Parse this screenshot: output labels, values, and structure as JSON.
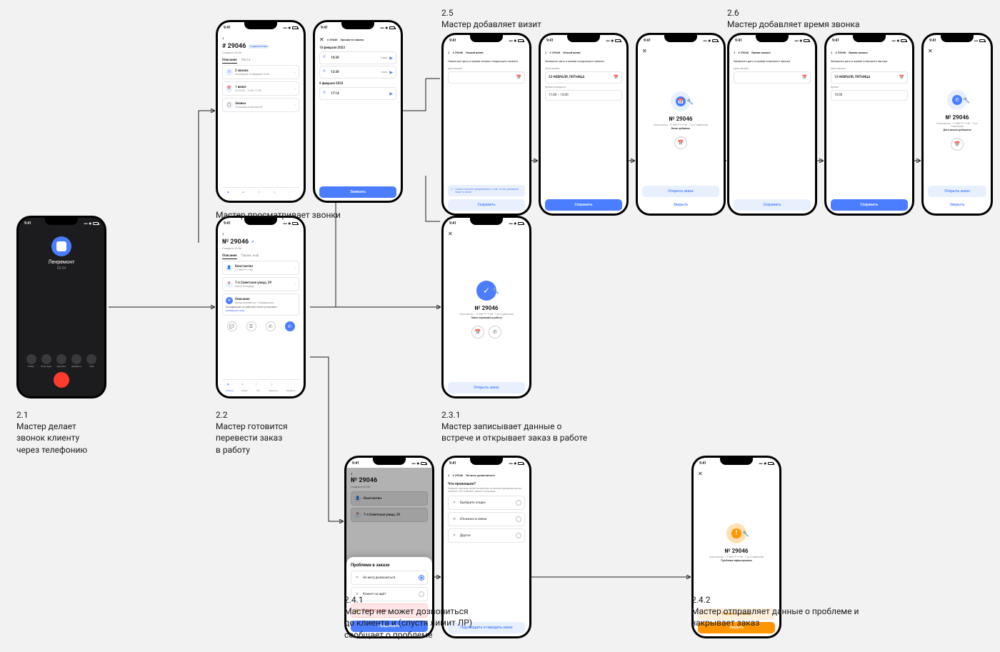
{
  "status_time": "9:41",
  "captions": {
    "c21": {
      "num": "2.1",
      "text": "Мастер делает\nзвонок клиенту\nчерез телефонию"
    },
    "c22": {
      "num": "2.2",
      "text": "Мастер готовится\nперевести заказ\nв работу"
    },
    "c_calls": "Мастер просматривает звонки",
    "c25": {
      "num": "2.5",
      "text": "Мастер добавляет визит"
    },
    "c26": {
      "num": "2.6",
      "text": "Мастер добавляет время звонка"
    },
    "c231": {
      "num": "2.3.1",
      "text": "Мастер записывает данные о\nвстрече и открывает заказ в работе"
    },
    "c241": {
      "num": "2.4.1",
      "text": "Мастер не может дозвониться\nдо клиента и (спустя лимит ЛР)\nсообщает о проблеме"
    },
    "c242": {
      "num": "2.4.2",
      "text": "Мастер отправляет данные о проблеме и\nзакрывает заказ"
    }
  },
  "call_screen": {
    "name": "Ленремонт",
    "duration": "00:04",
    "buttons": [
      "Набор",
      "Выкл звук",
      "Динамик",
      "Добавить",
      "Ещё"
    ]
  },
  "order": {
    "number": "# 29046",
    "number_plain": "№ 29046",
    "badge": "К диагностике",
    "created": "Создано 30.06",
    "tabs": [
      "Описание",
      "Лента"
    ],
    "tabs2": [
      "Описание",
      "Парам. инф."
    ],
    "calls_card": {
      "title": "2 звонка",
      "sub": "Последний 18 февраля 10:04"
    },
    "visit_card": {
      "title": "1 визит",
      "sub": "Пн 23.02 · 12:00–17:00"
    },
    "task_card": {
      "title": "Заявка",
      "sub": "Установка и монтаж БТ"
    },
    "client_card": {
      "title": "Константин",
      "sub": "+7 906 *** ** 60"
    },
    "address_card": {
      "title": "7-я Советская улица, 29",
      "sub": "Санкт-Петербург"
    },
    "desc_card": {
      "title": "Описание",
      "sub": "Бренд неизвестен · Холодильник",
      "body": "Холодильник не работает после установки...",
      "more": "развернуть ещё"
    }
  },
  "nav": [
    "Заказы",
    "Карта",
    "Чат",
    "Финансы",
    "Профиль"
  ],
  "calls_log": {
    "header_label": "Звонки по заказу",
    "date1": "10 февраля 2023",
    "items1": [
      {
        "time": "10:39",
        "dur": "2 мин"
      },
      {
        "time": "12:36",
        "dur": "5 мин"
      }
    ],
    "date2": "9 февраля 2023",
    "items2": [
      {
        "time": "17:14",
        "dur": ""
      }
    ],
    "action": "Записать"
  },
  "visit_form": {
    "breadcrumb": "Новый визит",
    "title1": "Назначьте дату и время начала следующего визита",
    "date_label": "Дата визита",
    "date_value": "",
    "title2": "Запишите дату и время следующего визита",
    "date_big": "22 ФЕВРАЛЯ, ПЯТНИЦА",
    "time_label": "Время и продолж.",
    "time_value": "11:00 – 14:00",
    "save": "Сохранить",
    "info": "Клиент получит уведомление о том, что вы добавили визит в заказ"
  },
  "visit_success": {
    "title": "№ 29046",
    "sub1": "Константин · +7 906 *** ** 60 · 7 р-н Советская",
    "sub2": "Визит добавлен",
    "action1": "Открыть заказ",
    "action2": "Закрыть"
  },
  "call_time_form": {
    "breadcrumb": "Время звонка",
    "title1": "Запишите дату и время планового звонка",
    "date_label": "Дата звонка",
    "title2": "Запишите дату и время планового звонка",
    "date_big": "13 ФЕВРАЛЯ, ПЯТНИЦА",
    "time_label": "Время",
    "time_value": "10:00",
    "save": "Сохранить"
  },
  "call_success": {
    "title": "№ 29046",
    "sub1": "Константин · +7 906 *** ** 60 · 7 р-н Советская",
    "sub2": "Дата звонка добавлена",
    "action1": "Открыть заказ",
    "action2": "Закрыть"
  },
  "work_success": {
    "title": "№ 29046",
    "sub1": "Константин · +7 906 *** ** 60 · 7 р-н Советская",
    "sub2": "Заказ переведён в работу",
    "action": "Открыть заказ"
  },
  "problem_sheet": {
    "title": "Проблема в заказе",
    "items": [
      {
        "icon": "✕",
        "label": "Не могу дозвониться",
        "checked": true
      },
      {
        "icon": "⊘",
        "label": "Клиент не идёт",
        "checked": false
      },
      {
        "icon": "🔒",
        "label": "Отказ от заказа",
        "danger": true
      }
    ],
    "action": "Продолжить"
  },
  "problem_form": {
    "breadcrumb": "Не могу дозвониться",
    "title": "Что произошло?",
    "sub": "Укажите причину, из-за которой вы не можете дозвониться до клиента. Это поможет решить ситуацию",
    "options": [
      {
        "icon": "✕",
        "label": "Выберите опцию"
      },
      {
        "icon": "⊘",
        "label": "Отказано в связи"
      },
      {
        "icon": "✕",
        "label": "Другое"
      }
    ],
    "action": "Подтвердить и передать заказ"
  },
  "problem_result": {
    "title": "№ 29046",
    "sub1": "Константин · +7 906 *** ** 60 · 7 р-н Советская",
    "sub2": "Проблема зафиксирована",
    "action1": "Перейти к заказу",
    "action2": "Закрыть"
  }
}
